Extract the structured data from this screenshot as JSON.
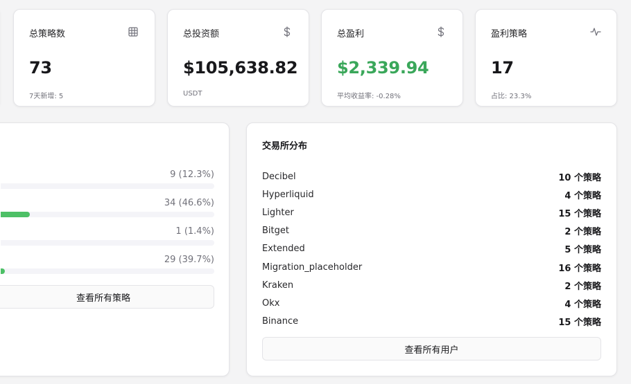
{
  "stats": [
    {
      "title": "总策略数",
      "value": "73",
      "sub": "7天新增: 5",
      "icon": "grid-icon"
    },
    {
      "title": "总投资额",
      "value": "$105,638.82",
      "sub": "USDT",
      "icon": "dollar-icon"
    },
    {
      "title": "总盈利",
      "value": "$2,339.94",
      "sub": "平均收益率: -0.28%",
      "icon": "dollar-icon",
      "color": "#3aa75a"
    },
    {
      "title": "盈利策略",
      "value": "17",
      "sub": "占比: 23.3%",
      "icon": "activity-icon"
    }
  ],
  "status_bars": [
    {
      "label": "9 (12.3%)",
      "fill_percent": 0
    },
    {
      "label": "34 (46.6%)",
      "fill_percent": 46.6
    },
    {
      "label": "1 (1.4%)",
      "fill_percent": 0
    },
    {
      "label": "29 (39.7%)",
      "fill_percent": 39.7
    }
  ],
  "left_panel": {
    "button_label": "查看所有策略"
  },
  "exchange_panel": {
    "title": "交易所分布",
    "items": [
      {
        "name": "Decibel",
        "count": "10 个策略"
      },
      {
        "name": "Hyperliquid",
        "count": "4 个策略"
      },
      {
        "name": "Lighter",
        "count": "15 个策略"
      },
      {
        "name": "Bitget",
        "count": "2 个策略"
      },
      {
        "name": "Extended",
        "count": "5 个策略"
      },
      {
        "name": "Migration_placeholder",
        "count": "16 个策略"
      },
      {
        "name": "Kraken",
        "count": "2 个策略"
      },
      {
        "name": "Okx",
        "count": "4 个策略"
      },
      {
        "name": "Binance",
        "count": "15 个策略"
      }
    ],
    "button_label": "查看所有用户"
  },
  "colors": {
    "accent_green": "#4dc066",
    "profit_green": "#3aa75a"
  }
}
